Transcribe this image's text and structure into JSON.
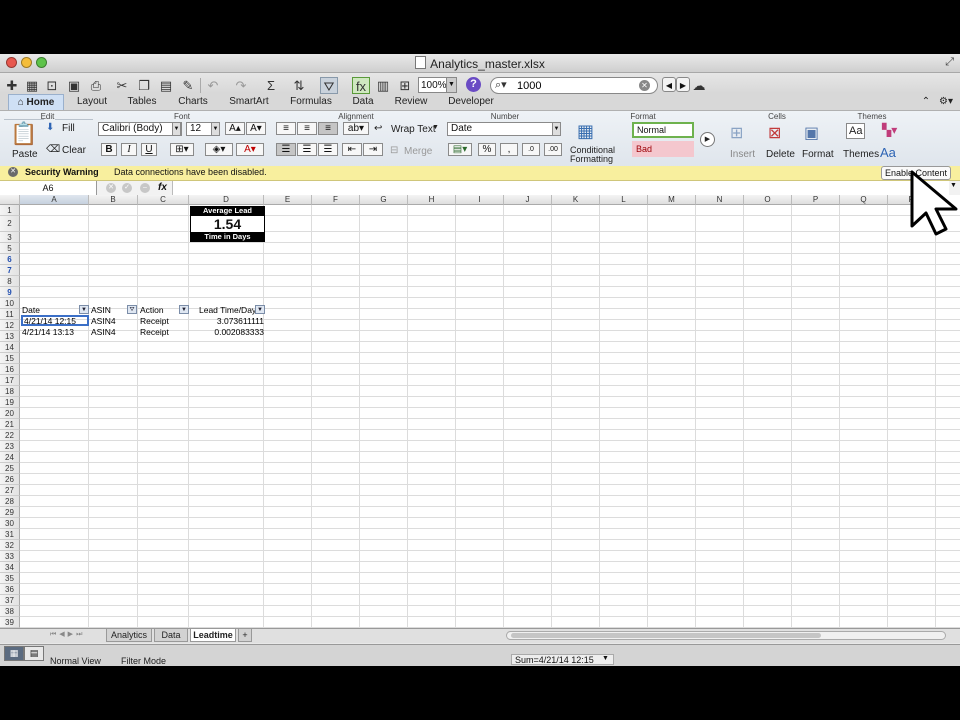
{
  "window": {
    "title": "Analytics_master.xlsx"
  },
  "toolbar": {
    "zoom": "100%",
    "search_value": "1000"
  },
  "ribbon_tabs": [
    "Home",
    "Layout",
    "Tables",
    "Charts",
    "SmartArt",
    "Formulas",
    "Data",
    "Review",
    "Developer"
  ],
  "active_tab": "Home",
  "ribbon": {
    "groups": {
      "edit": "Edit",
      "font": "Font",
      "alignment": "Alignment",
      "number": "Number",
      "format": "Format",
      "cells": "Cells",
      "themes": "Themes"
    },
    "paste": "Paste",
    "fill": "Fill",
    "clear": "Clear",
    "font_name": "Calibri (Body)",
    "font_size": "12",
    "wrap_text": "Wrap Text",
    "merge": "Merge",
    "number_format": "Date",
    "conditional_formatting_1": "Conditional",
    "conditional_formatting_2": "Formatting",
    "style_normal": "Normal",
    "style_bad": "Bad",
    "insert": "Insert",
    "delete": "Delete",
    "format": "Format",
    "themes": "Themes",
    "bold": "B",
    "italic": "I",
    "underline": "U",
    "percent": "%",
    "comma": ",",
    "aa": "Aa"
  },
  "security_bar": {
    "title": "Security Warning",
    "message": "Data connections have been disabled.",
    "button": "Enable Content"
  },
  "formula_bar": {
    "name_box": "A6",
    "fx": "fx",
    "value": ""
  },
  "sheet": {
    "columns": [
      "A",
      "B",
      "C",
      "D",
      "E",
      "F",
      "G",
      "H",
      "I",
      "J",
      "K",
      "L",
      "M",
      "N",
      "O",
      "P",
      "Q",
      "R"
    ],
    "rows": [
      "1",
      "2",
      "3",
      "5",
      "6",
      "7",
      "8",
      "9",
      "10",
      "11",
      "12",
      "13",
      "14",
      "15",
      "16",
      "17",
      "18",
      "19",
      "20",
      "21",
      "22",
      "23",
      "24",
      "25",
      "26",
      "27",
      "28",
      "29",
      "30",
      "31",
      "32",
      "33",
      "34",
      "35",
      "36",
      "37",
      "38",
      "39"
    ],
    "summary": {
      "title": "Average Lead",
      "value": "1.54",
      "subtitle": "Time in Days"
    },
    "headers": [
      "Date",
      "ASIN",
      "Action",
      "Lead Time/Days"
    ],
    "data": [
      [
        "4/21/14 12:15",
        "ASIN4",
        "Receipt",
        "3.073611111"
      ],
      [
        "4/21/14 13:13",
        "ASIN4",
        "Receipt",
        "0.002083333"
      ]
    ]
  },
  "sheet_tabs": [
    "Analytics",
    "Data",
    "Leadtime"
  ],
  "active_sheet": "Leadtime",
  "status": {
    "view": "Normal View",
    "mode": "Filter Mode",
    "sum": "Sum=4/21/14 12:15"
  }
}
